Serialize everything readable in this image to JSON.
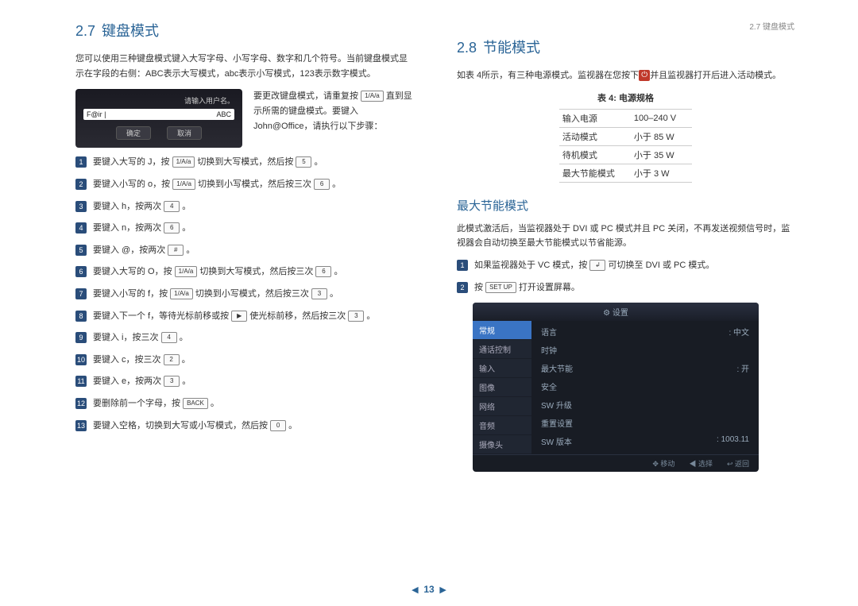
{
  "header": {
    "running": "2.7 键盘模式"
  },
  "s27": {
    "num": "2.7",
    "title": "键盘模式",
    "intro": "您可以使用三种键盘模式键入大写字母、小写字母、数字和几个符号。当前键盘模式显示在字段的右侧：ABC表示大写模式，abc表示小写模式，123表示数字模式。",
    "login": {
      "prompt": "请输入用户名。",
      "value": "F@ir |",
      "mode": "ABC",
      "ok": "确定",
      "cancel": "取消"
    },
    "intro2_a": "要更改键盘模式，请重复按",
    "intro2_b": "直到显示所需的键盘模式。要键入 John@Office，请执行以下步骤：",
    "keys": {
      "mode": "1/A/a",
      "k5": "5",
      "k6": "6",
      "k4": "4",
      "khash": "#",
      "k3": "3",
      "k2": "2",
      "arrowL": "◀",
      "arrowR": "▶",
      "back": "BACK",
      "k0": "0"
    },
    "steps": [
      {
        "t": "要键入大写的 J，按 [mode] 切换到大写模式，然后按 [k5] 。"
      },
      {
        "t": "要键入小写的 o，按 [mode] 切换到小写模式，然后按三次 [k6] 。"
      },
      {
        "t": "要键入 h，按两次 [k4] 。"
      },
      {
        "t": "要键入 n，按两次 [k6] 。"
      },
      {
        "t": "要键入 @，按两次 [khash] 。"
      },
      {
        "t": "要键入大写的 O，按 [mode] 切换到大写模式，然后按三次 [k6] 。"
      },
      {
        "t": "要键入小写的 f，按 [mode] 切换到小写模式，然后按三次 [k3] 。"
      },
      {
        "t": "要键入下一个 f，等待光标前移或按 [arrowR] 使光标前移，然后按三次 [k3] 。"
      },
      {
        "t": "要键入 i，按三次 [k4] 。"
      },
      {
        "t": "要键入 c，按三次 [k2] 。"
      },
      {
        "t": "要键入 e，按两次 [k3] 。"
      },
      {
        "t": "要删除前一个字母，按 [back] 。"
      },
      {
        "t": "要键入空格，切换到大写或小写模式，然后按 [k0] 。"
      }
    ]
  },
  "s28": {
    "num": "2.8",
    "title": "节能模式",
    "intro_a": "如表 4所示，有三种电源模式。监视器在您按下",
    "intro_b": "并且监视器打开后进入活动模式。",
    "table": {
      "caption": "表 4: 电源规格",
      "rows": [
        [
          "输入电源",
          "100–240 V"
        ],
        [
          "活动模式",
          "小于 85 W"
        ],
        [
          "待机模式",
          "小于 35 W"
        ],
        [
          "最大节能模式",
          "小于 3 W"
        ]
      ]
    },
    "sub": {
      "title": "最大节能模式",
      "para": "此模式激活后，当监视器处于 DVI 或 PC 模式并且 PC 关闭，不再发送视频信号时，监视器会自动切换至最大节能模式以节省能源。",
      "steps": [
        {
          "a": "如果监视器处于 VC 模式，按 ",
          "k": "↲",
          "b": " 可切换至 DVI 或 PC 模式。"
        },
        {
          "a": "按 ",
          "k": "SET UP",
          "b": " 打开设置屏幕。"
        }
      ]
    },
    "settings": {
      "title": "设置",
      "side": [
        "常规",
        "通话控制",
        "输入",
        "图像",
        "网络",
        "音频",
        "摄像头"
      ],
      "main": [
        [
          "语言",
          ": 中文"
        ],
        [
          "时钟",
          ""
        ],
        [
          "最大节能",
          ": 开"
        ],
        [
          "安全",
          ""
        ],
        [
          "SW 升级",
          ""
        ],
        [
          "重置设置",
          ""
        ],
        [
          "SW 版本",
          ": 1003.11"
        ]
      ],
      "footer": [
        "✥ 移动",
        "◀ 选择",
        "↩ 返回"
      ]
    }
  },
  "pager": {
    "prev": "◀",
    "page": "13",
    "next": "▶"
  }
}
